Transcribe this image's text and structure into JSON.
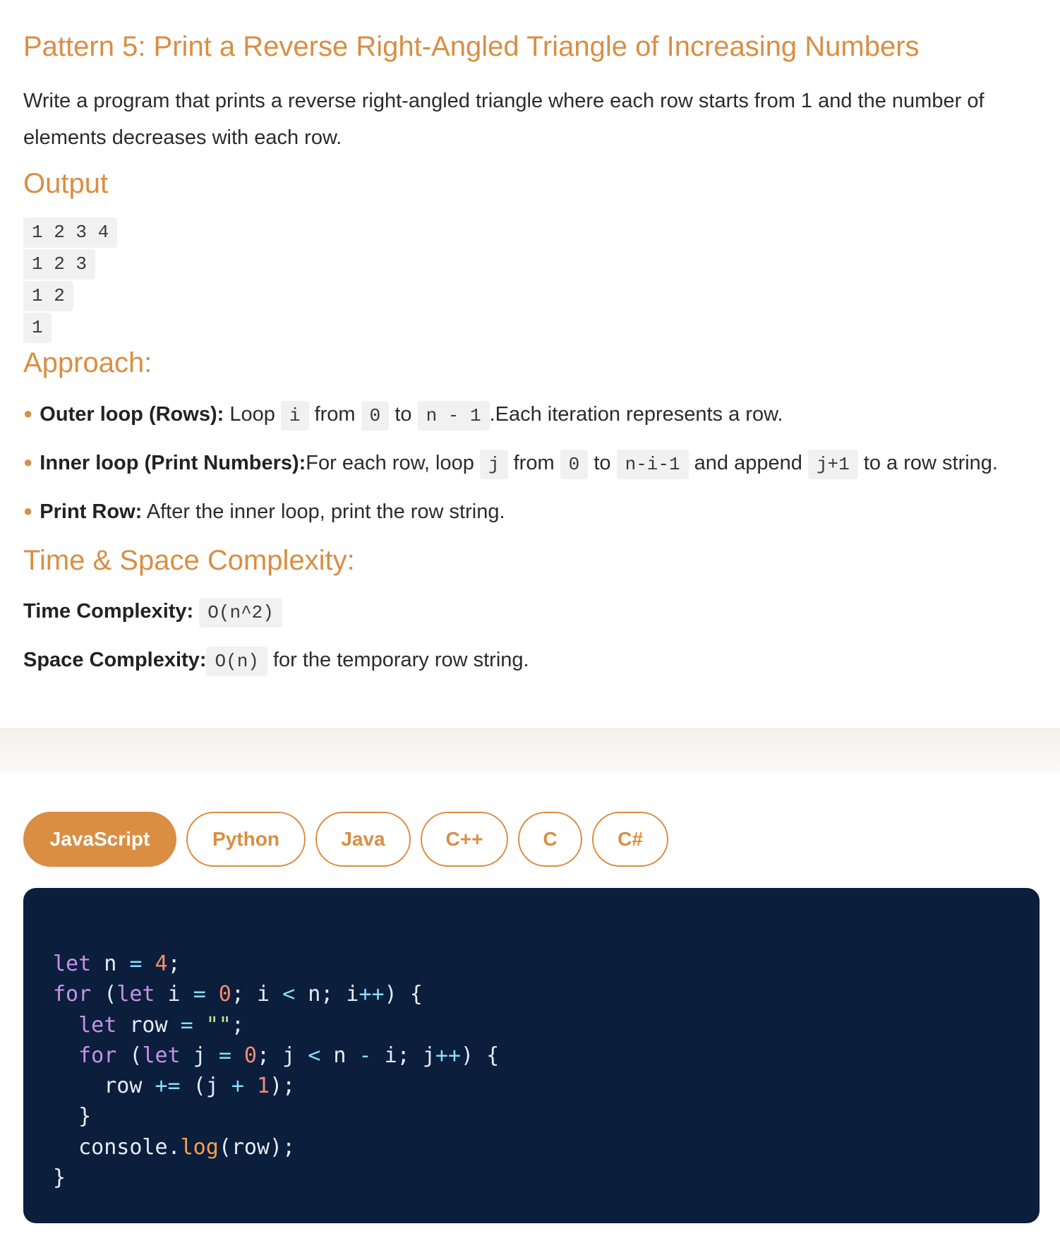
{
  "title": "Pattern 5: Print a Reverse Right-Angled Triangle of Increasing Numbers",
  "description": "Write a program that prints a reverse right-angled triangle where each row starts from 1 and the number of elements decreases with each row.",
  "output": {
    "heading": "Output",
    "lines": [
      "1 2 3 4",
      "1 2 3",
      "1 2",
      "1"
    ]
  },
  "approach": {
    "heading": "Approach:",
    "items": [
      {
        "label": "Outer loop (Rows):",
        "t1": " Loop ",
        "c1": "i",
        "t2": " from ",
        "c2": "0",
        "t3": " to ",
        "c3": "n - 1",
        "t4": ".Each iteration represents a row."
      },
      {
        "label": "Inner loop (Print Numbers):",
        "t1": "For each row, loop ",
        "c1": "j",
        "t2": " from ",
        "c2": "0",
        "t3": " to ",
        "c3": "n-i-1",
        "t4": " and append ",
        "c4": "j+1",
        "t5": " to a row string."
      },
      {
        "label": "Print Row:",
        "t1": " After the inner loop, print the row string."
      }
    ]
  },
  "complexity": {
    "heading": "Time & Space Complexity:",
    "time_label": "Time Complexity:",
    "time_value": "O(n^2)",
    "space_label": "Space Complexity:",
    "space_value": "O(n)",
    "space_note": " for the temporary row string."
  },
  "tabs": [
    "JavaScript",
    "Python",
    "Java",
    "C++",
    "C",
    "C#"
  ],
  "active_tab": "JavaScript",
  "code_tokens": {
    "l1_let": "let",
    "l1_n": " n ",
    "l1_eq": "=",
    "l1_4": " 4",
    "l1_end": ";",
    "l2_for": "for",
    "l2_p": " (",
    "l2_let": "let",
    "l2_i": " i ",
    "l2_eq": "=",
    "l2_0": " 0",
    "l2_s": "; i ",
    "l2_lt": "<",
    "l2_n": " n; i",
    "l2_pp": "++",
    "l2_end": ") {",
    "l3_ind": "  ",
    "l3_let": "let",
    "l3_row": " row ",
    "l3_eq": "=",
    "l3_str": " \"\"",
    "l3_end": ";",
    "l4_ind": "  ",
    "l4_for": "for",
    "l4_p": " (",
    "l4_let": "let",
    "l4_j": " j ",
    "l4_eq": "=",
    "l4_0": " 0",
    "l4_s": "; j ",
    "l4_lt": "<",
    "l4_n": " n ",
    "l4_m": "-",
    "l4_i": " i; j",
    "l4_pp": "++",
    "l4_end": ") {",
    "l5_ind": "    row ",
    "l5_pe": "+=",
    "l5_p": " (j ",
    "l5_plus": "+",
    "l5_1": " 1",
    "l5_end": ");",
    "l6": "  }",
    "l7_ind": "  console.",
    "l7_log": "log",
    "l7_end": "(row);",
    "l8": "}"
  }
}
